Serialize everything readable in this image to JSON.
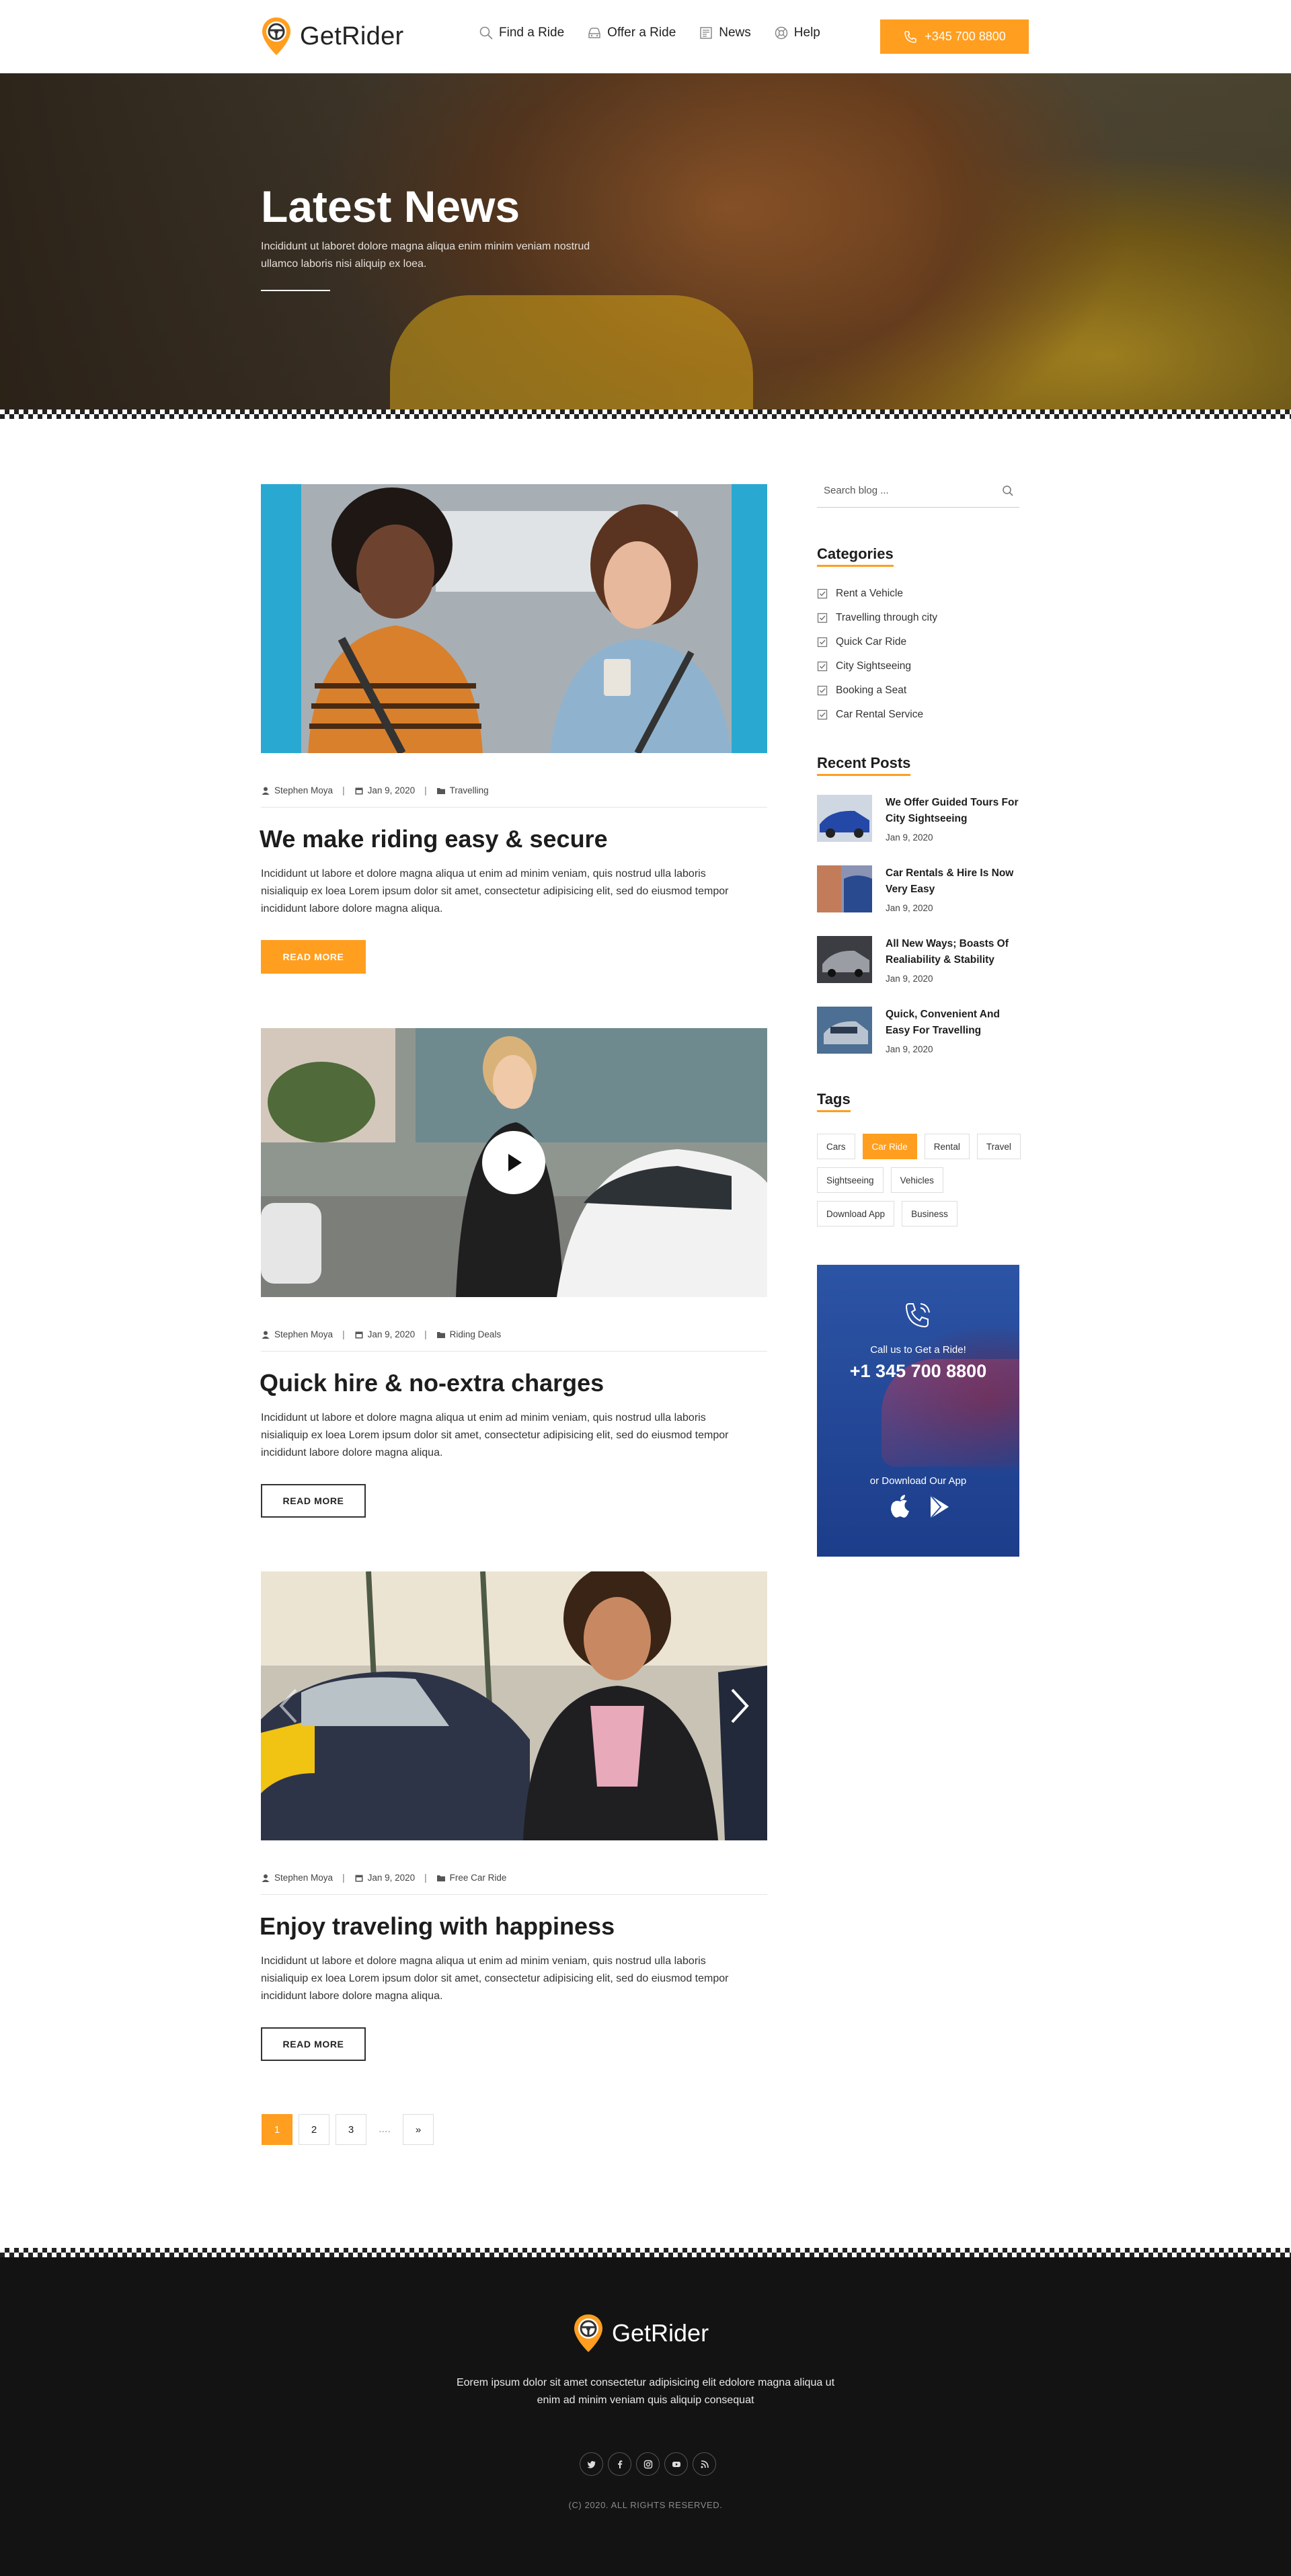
{
  "header": {
    "brand": "GetRider",
    "nav": [
      {
        "label": "Find a Ride",
        "icon": "search-icon"
      },
      {
        "label": "Offer a Ride",
        "icon": "car-icon"
      },
      {
        "label": "News",
        "icon": "newspaper-icon"
      },
      {
        "label": "Help",
        "icon": "lifebuoy-icon"
      }
    ],
    "phone": "+345 700 8800",
    "accent": "#ff9e1f"
  },
  "hero": {
    "title": "Latest News",
    "subtitle": "Incididunt ut laboret dolore magna aliqua enim minim veniam nostrud ullamco laboris nisi aliquip ex loea."
  },
  "posts": [
    {
      "author": "Stephen Moya",
      "date": "Jan 9, 2020",
      "category": "Travelling",
      "title": "We make riding easy & secure",
      "excerpt": "Incididunt ut labore et dolore magna aliqua ut enim ad minim veniam, quis nostrud ulla laboris nisialiquip ex loea Lorem ipsum dolor sit amet, consectetur adipisicing elit, sed do eiusmod tempor incididunt labore dolore magna aliqua.",
      "button": "READ MORE"
    },
    {
      "author": "Stephen Moya",
      "date": "Jan 9, 2020",
      "category": "Riding Deals",
      "title": "Quick hire & no-extra charges",
      "excerpt": "Incididunt ut labore et dolore magna aliqua ut enim ad minim veniam, quis nostrud ulla laboris nisialiquip ex loea Lorem ipsum dolor sit amet, consectetur adipisicing elit, sed do eiusmod tempor incididunt labore dolore magna aliqua.",
      "button": "READ MORE"
    },
    {
      "author": "Stephen Moya",
      "date": "Jan 9, 2020",
      "category": "Free Car Ride",
      "title": "Enjoy traveling with happiness",
      "excerpt": "Incididunt ut labore et dolore magna aliqua ut enim ad minim veniam, quis nostrud ulla laboris nisialiquip ex loea Lorem ipsum dolor sit amet, consectetur adipisicing elit, sed do eiusmod tempor incididunt labore dolore magna aliqua.",
      "button": "READ MORE"
    }
  ],
  "pagination": {
    "pages": [
      "1",
      "2",
      "3"
    ],
    "dots": "....",
    "next": "»",
    "active": "1"
  },
  "sidebar": {
    "search_placeholder": "Search blog ...",
    "categories_title": "Categories",
    "categories": [
      "Rent a Vehicle",
      "Travelling through city",
      "Quick Car Ride",
      "City Sightseeing",
      "Booking a Seat",
      "Car Rental Service"
    ],
    "recent_title": "Recent Posts",
    "recent": [
      {
        "title": "We Offer Guided Tours For City Sightseeing",
        "date": "Jan 9, 2020"
      },
      {
        "title": "Car Rentals & Hire Is Now Very Easy",
        "date": "Jan 9, 2020"
      },
      {
        "title": "All New Ways; Boasts Of Realiability & Stability",
        "date": "Jan 9, 2020"
      },
      {
        "title": "Quick, Convenient And Easy For Travelling",
        "date": "Jan 9, 2020"
      }
    ],
    "tags_title": "Tags",
    "tags": [
      "Cars",
      "Car Ride",
      "Rental",
      "Travel",
      "Sightseeing",
      "Vehicles",
      "Download App",
      "Business"
    ],
    "active_tag": "Car Ride",
    "promo": {
      "call_text": "Call us to Get a Ride!",
      "phone": "+1 345 700 8800",
      "download_text": "or Download Our App",
      "bg": "#2c54a5"
    }
  },
  "footer": {
    "brand": "GetRider",
    "text": "Eorem ipsum dolor sit amet consectetur adipisicing elit edolore magna aliqua ut enim ad minim veniam quis aliquip consequat",
    "socials": [
      "twitter-icon",
      "facebook-icon",
      "instagram-icon",
      "youtube-icon",
      "rss-icon"
    ],
    "copyright": "(C) 2020. ALL RIGHTS RESERVED."
  }
}
